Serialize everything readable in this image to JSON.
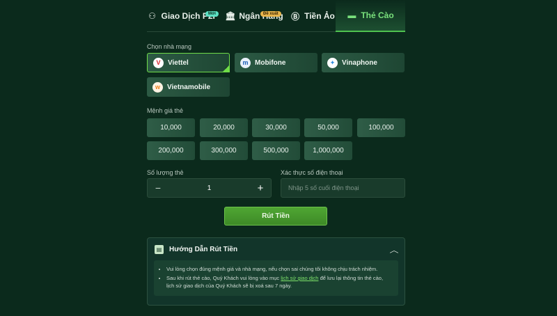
{
  "tabs": [
    {
      "label": "Giao Dịch P2P",
      "badge": "Mới",
      "icon": "exchange-icon"
    },
    {
      "label": "Ngân Hàng",
      "badge": "Đề xuất",
      "icon": "bank-icon"
    },
    {
      "label": "Tiền Ảo",
      "icon": "crypto-icon"
    },
    {
      "label": "Thẻ Cào",
      "icon": "card-icon",
      "active": true
    }
  ],
  "carrier_section": {
    "label": "Chọn nhà mạng",
    "carriers": [
      "Viettel",
      "Mobifone",
      "Vinaphone",
      "Vietnamobile"
    ],
    "selected": "Viettel"
  },
  "denom_section": {
    "label": "Mệnh giá thẻ",
    "values": [
      "10,000",
      "20,000",
      "30,000",
      "50,000",
      "100,000",
      "200,000",
      "300,000",
      "500,000",
      "1,000,000"
    ]
  },
  "quantity": {
    "label": "Số lượng thẻ",
    "minus": "−",
    "value": "1",
    "plus": "+"
  },
  "phone": {
    "label": "Xác thực số điện thoại",
    "placeholder": "Nhập 5 số cuối điện thoại"
  },
  "submit_label": "Rút Tiền",
  "guide": {
    "title": "Hướng Dẫn Rút Tiền",
    "item1": "Vui lòng chọn đúng mệnh giá và nhà mạng, nếu chọn sai chúng tôi không chịu trách nhiệm.",
    "item2_before": "Sau khi rút thẻ cào, Quý Khách vui lòng vào mục ",
    "item2_link": "lịch sử giao dịch",
    "item2_after": " để lưu lại thông tin thẻ cào, lịch sử giao dịch của Quý Khách sẽ bị xoá sau 7 ngày."
  },
  "colors": {
    "background": "#0b2a1c",
    "accent": "#6fdc48",
    "button": "#4fa633"
  }
}
